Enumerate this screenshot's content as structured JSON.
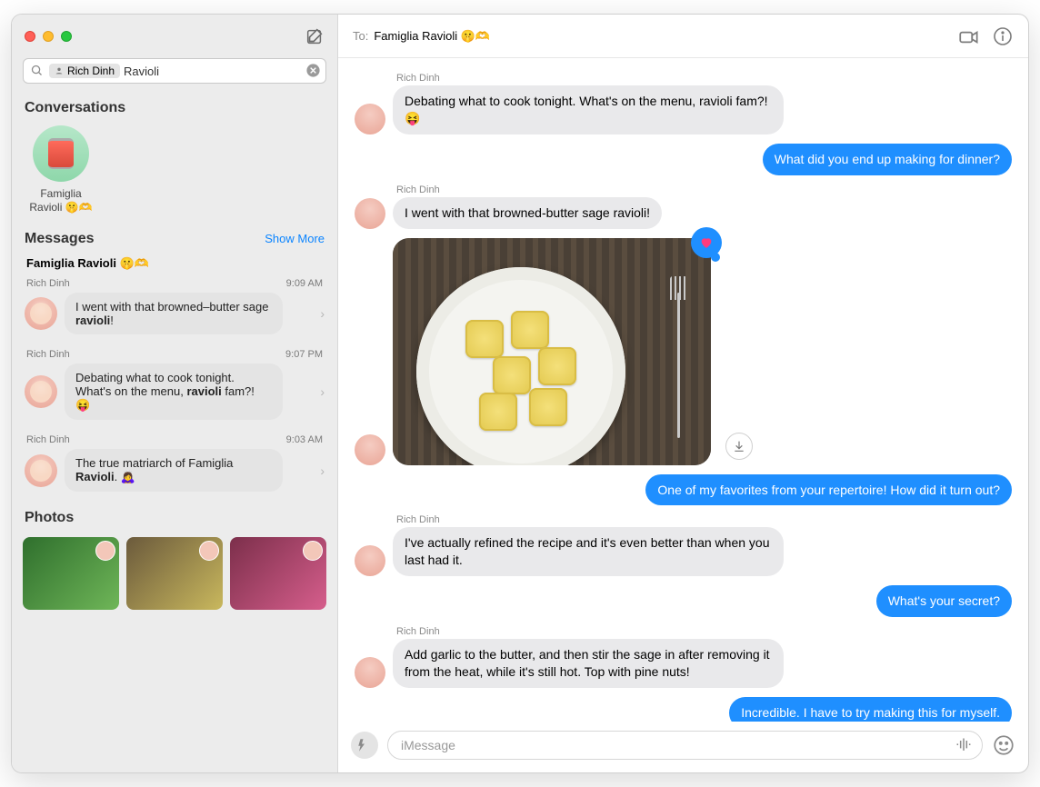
{
  "search": {
    "pill_name": "Rich Dinh",
    "query": "Ravioli"
  },
  "sidebar": {
    "conversations_label": "Conversations",
    "pinned": {
      "line1": "Famiglia",
      "line2": "Ravioli 🤫🫶"
    },
    "messages_label": "Messages",
    "show_more": "Show More",
    "thread_title": "Famiglia Ravioli 🤫🫶",
    "items": [
      {
        "sender": "Rich Dinh",
        "time": "9:09 AM",
        "text_html": "I went with that browned–butter sage <b>ravioli</b>!"
      },
      {
        "sender": "Rich Dinh",
        "time": "9:07 PM",
        "text_html": "Debating what to cook tonight. What's on the menu, <b>ravioli</b> fam?! 😝"
      },
      {
        "sender": "Rich Dinh",
        "time": "9:03 AM",
        "text_html": "The true matriarch of Famiglia <b>Ravioli</b>. 🙇‍♀️"
      }
    ],
    "photos_label": "Photos"
  },
  "header": {
    "to_label": "To:",
    "to_value": "Famiglia Ravioli 🤫🫶"
  },
  "thread": [
    {
      "kind": "in",
      "sender": "Rich Dinh",
      "text": "Debating what to cook tonight. What's on the menu, ravioli fam?! 😝"
    },
    {
      "kind": "out",
      "text": "What did you end up making for dinner?"
    },
    {
      "kind": "in",
      "sender": "Rich Dinh",
      "text": "I went with that browned-butter sage ravioli!"
    },
    {
      "kind": "image",
      "tapback": "heart"
    },
    {
      "kind": "out",
      "text": "One of my favorites from your repertoire! How did it turn out?"
    },
    {
      "kind": "in",
      "sender": "Rich Dinh",
      "text": "I've actually refined the recipe and it's even better than when you last had it."
    },
    {
      "kind": "out",
      "text": "What's your secret?"
    },
    {
      "kind": "in",
      "sender": "Rich Dinh",
      "text": "Add garlic to the butter, and then stir the sage in after removing it from the heat, while it's still hot. Top with pine nuts!"
    },
    {
      "kind": "out",
      "text": "Incredible. I have to try making this for myself."
    }
  ],
  "composer": {
    "placeholder": "iMessage"
  }
}
